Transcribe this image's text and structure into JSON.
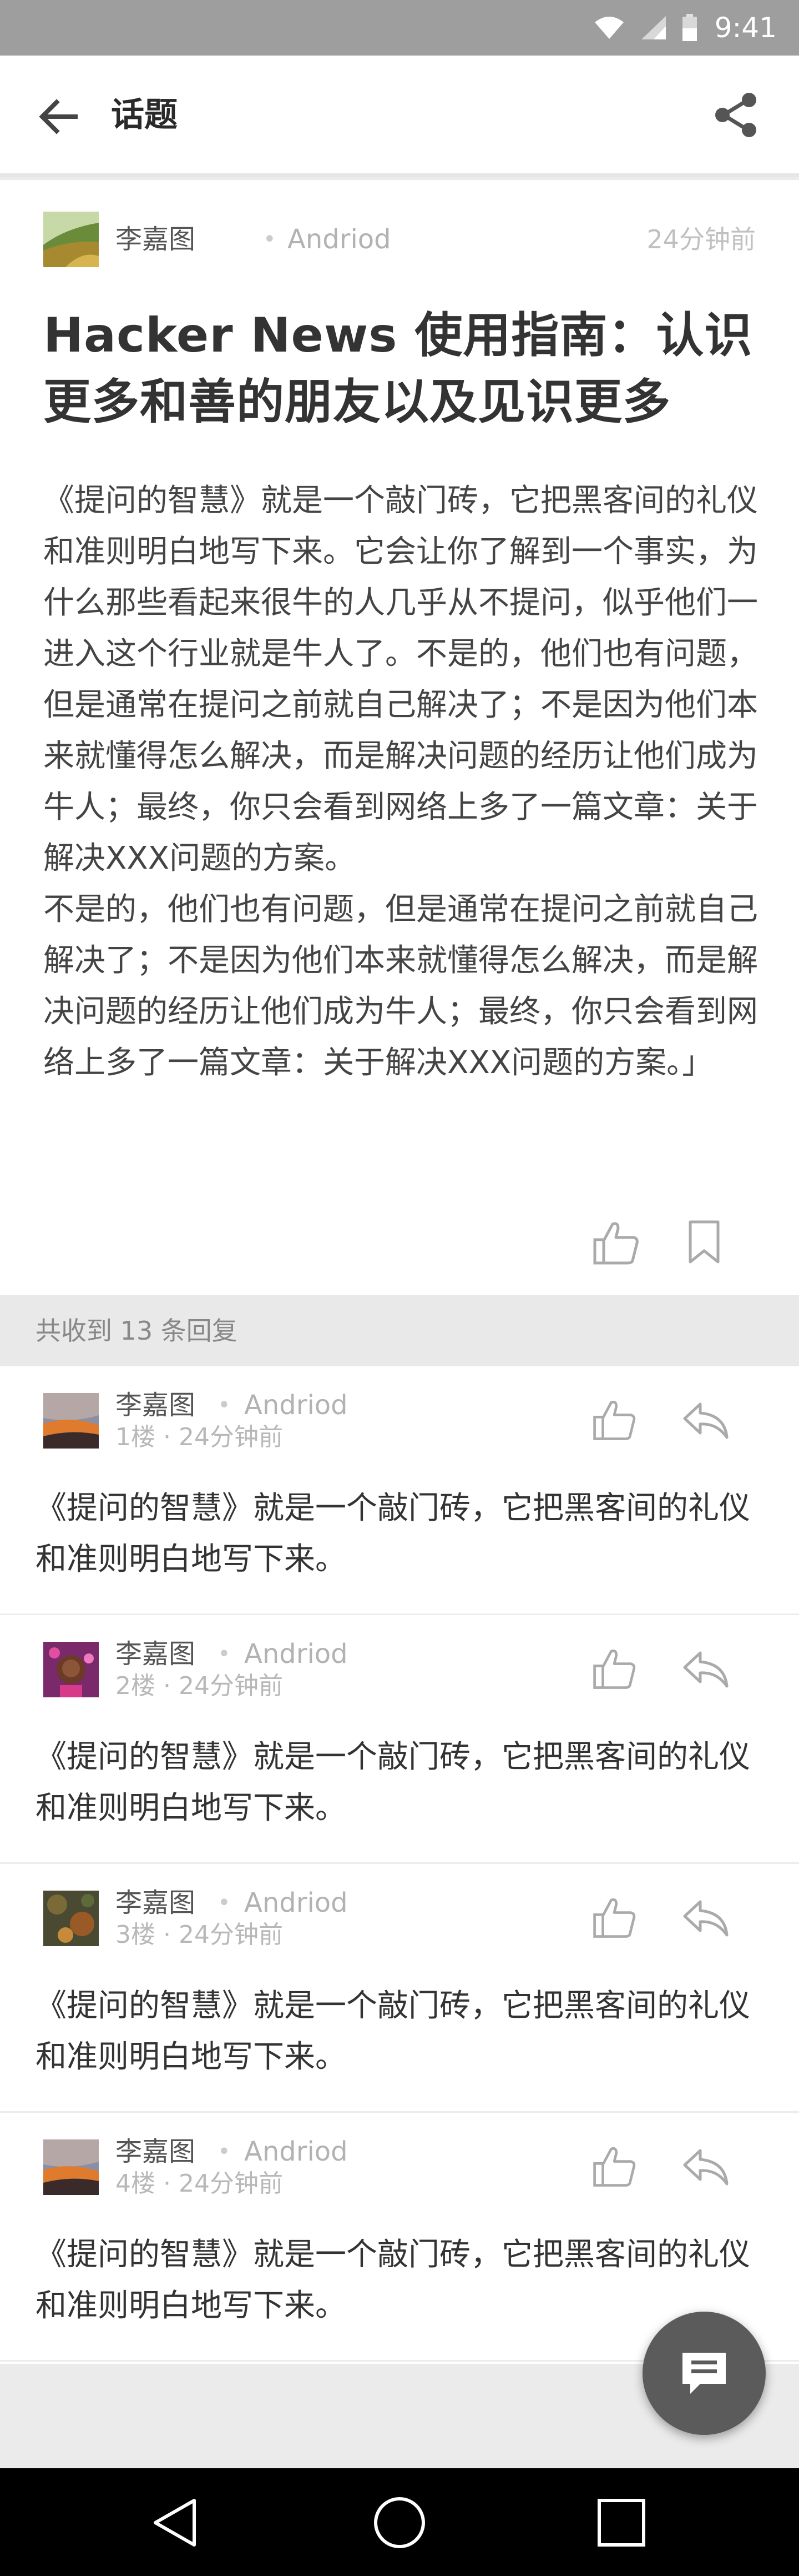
{
  "status_bar": {
    "time": "9:41",
    "icons": [
      "wifi-icon",
      "signal-icon",
      "battery-icon"
    ]
  },
  "header": {
    "title": "话题",
    "back_icon": "arrow-left-icon",
    "share_icon": "share-icon"
  },
  "article": {
    "author": "李嘉图",
    "separator": "•",
    "platform": "Andriod",
    "time": "24分钟前",
    "title": "Hacker News 使用指南：认识更多和善的朋友以及见识更多",
    "body": "《提问的智慧》就是一个敲门砖，它把黑客间的礼仪和准则明白地写下来。它会让你了解到一个事实，为什么那些看起来很牛的人几乎从不提问，似乎他们一进入这个行业就是牛人了。不是的，他们也有问题，但是通常在提问之前就自己解决了；不是因为他们本来就懂得怎么解决，而是解决问题的经历让他们成为牛人；最终，你只会看到网络上多了一篇文章：关于解决XXX问题的方案。\n不是的，他们也有问题，但是通常在提问之前就自己解决了；不是因为他们本来就懂得怎么解决，而是解决问题的经历让他们成为牛人；最终，你只会看到网络上多了一篇文章：关于解决XXX问题的方案。」",
    "like_icon": "thumbs-up-icon",
    "bookmark_icon": "bookmark-icon"
  },
  "replies": {
    "count_text": "共收到 13 条回复",
    "items": [
      {
        "author": "李嘉图",
        "separator": "•",
        "platform": "Andriod",
        "floor": "1楼 · 24分钟前",
        "text": "《提问的智慧》就是一个敲门砖，它把黑客间的礼仪和准则明白地写下来。"
      },
      {
        "author": "李嘉图",
        "separator": "•",
        "platform": "Andriod",
        "floor": "2楼 · 24分钟前",
        "text": "《提问的智慧》就是一个敲门砖，它把黑客间的礼仪和准则明白地写下来。"
      },
      {
        "author": "李嘉图",
        "separator": "•",
        "platform": "Andriod",
        "floor": "3楼 · 24分钟前",
        "text": "《提问的智慧》就是一个敲门砖，它把黑客间的礼仪和准则明白地写下来。"
      },
      {
        "author": "李嘉图",
        "separator": "•",
        "platform": "Andriod",
        "floor": "4楼 · 24分钟前",
        "text": "《提问的智慧》就是一个敲门砖，它把黑客间的礼仪和准则明白地写下来。"
      }
    ]
  },
  "fab": {
    "icon": "comment-icon"
  },
  "nav_bar": {
    "icons": [
      "nav-back-icon",
      "nav-home-icon",
      "nav-recents-icon"
    ]
  },
  "colors": {
    "status_bar": "#9e9e9e",
    "fab": "#5b5b5b",
    "divider": "#e9e9e9",
    "nav_bar": "#000000"
  }
}
